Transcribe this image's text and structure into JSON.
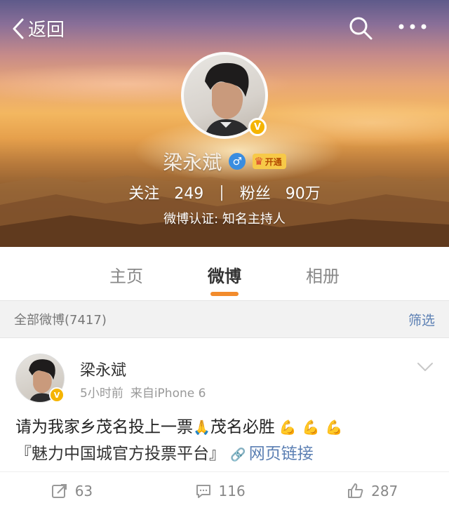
{
  "nav": {
    "back_label": "返回",
    "search_icon": "search-icon",
    "more_icon": "more-icon"
  },
  "profile": {
    "name": "梁永斌",
    "gender_symbol": "♂",
    "vip_label": "开通",
    "verified_mark": "V",
    "following_label": "关注",
    "following_count": "249",
    "fans_label": "粉丝",
    "fans_count": "90万",
    "certification": "微博认证: 知名主持人"
  },
  "tabs": [
    {
      "label": "主页"
    },
    {
      "label": "微博"
    },
    {
      "label": "相册"
    }
  ],
  "filter_bar": {
    "count_label": "全部微博(7417)",
    "filter_label": "筛选"
  },
  "post": {
    "author": "梁永斌",
    "time": "5小时前",
    "source": "来自iPhone 6",
    "text_line1_a": "请为我家乡茂名投上一票",
    "text_line1_b": "茂名必胜",
    "topic": "『魅力中国城官方投票平台』",
    "link_label": "网页链接",
    "reposts": "63",
    "comments": "116",
    "likes": "287"
  },
  "colors": {
    "accent_orange": "#f28b2c",
    "link_blue": "#5b7fb3",
    "verified_gold": "#f5b400"
  }
}
